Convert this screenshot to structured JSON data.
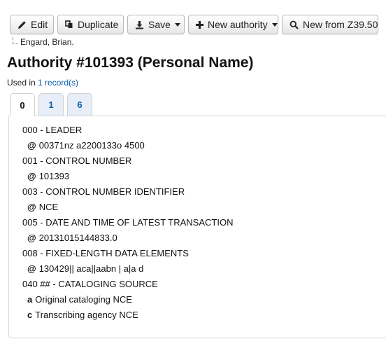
{
  "toolbar": {
    "edit_label": "Edit",
    "duplicate_label": "Duplicate",
    "save_label": "Save",
    "new_authority_label": "New authority",
    "new_from_z_label": "New from Z39.50"
  },
  "breadcrumb": {
    "text": "Engard, Brian."
  },
  "page": {
    "title": "Authority #101393 (Personal Name)",
    "used_prefix": "Used in",
    "used_link": "1 record(s)"
  },
  "tabs": [
    {
      "label": "0"
    },
    {
      "label": "1"
    },
    {
      "label": "6"
    }
  ],
  "fields": [
    {
      "heading": "000 - LEADER",
      "subfields": [
        {
          "code": "@",
          "value": "00371nz a2200133o 4500"
        }
      ]
    },
    {
      "heading": "001 - CONTROL NUMBER",
      "subfields": [
        {
          "code": "@",
          "value": "101393"
        }
      ]
    },
    {
      "heading": "003 - CONTROL NUMBER IDENTIFIER",
      "subfields": [
        {
          "code": "@",
          "value": "NCE"
        }
      ]
    },
    {
      "heading": "005 - DATE AND TIME OF LATEST TRANSACTION",
      "subfields": [
        {
          "code": "@",
          "value": "20131015144833.0"
        }
      ]
    },
    {
      "heading": "008 - FIXED-LENGTH DATA ELEMENTS",
      "subfields": [
        {
          "code": "@",
          "value": "130429|| aca||aabn | a|a d"
        }
      ]
    },
    {
      "heading": "040 ## - CATALOGING SOURCE",
      "subfields": [
        {
          "code": "a",
          "value": "Original cataloging NCE"
        },
        {
          "code": "c",
          "value": "Transcribing agency NCE"
        }
      ]
    }
  ]
}
